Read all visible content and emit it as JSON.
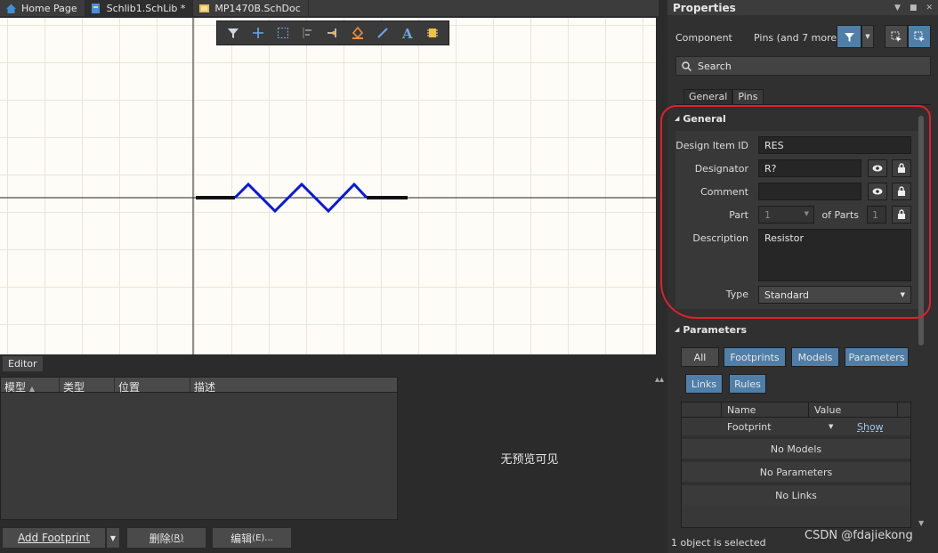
{
  "tabs": [
    {
      "label": "Home Page",
      "icon": "home-icon"
    },
    {
      "label": "Schlib1.SchLib *",
      "icon": "schlib-file-icon"
    },
    {
      "label": "MP1470B.SchDoc",
      "icon": "schdoc-file-icon"
    }
  ],
  "canvas_toolbar": {
    "tools": [
      "filter-icon",
      "add-crosshair-icon",
      "select-rect-icon",
      "align-icon",
      "pin-icon",
      "fill-icon",
      "line-icon",
      "text-icon",
      "component-icon"
    ]
  },
  "editor": {
    "tab_label": "Editor",
    "columns": [
      "模型",
      "类型",
      "位置",
      "描述"
    ],
    "preview_empty": "无预览可见",
    "buttons": {
      "add_footprint": "Add Footprint",
      "delete": "删除 ",
      "delete_key": "(R)",
      "edit": "编辑 ",
      "edit_key": "(E)..."
    }
  },
  "properties": {
    "title": "Properties",
    "component_label": "Component",
    "selection_filter": "Pins (and 7 more)",
    "search_placeholder": "Search",
    "subtabs": [
      "General",
      "Pins"
    ],
    "general": {
      "header": "General",
      "design_item_id_label": "Design Item ID",
      "design_item_id": "RES",
      "designator_label": "Designator",
      "designator": "R?",
      "comment_label": "Comment",
      "comment": "",
      "part_label": "Part",
      "part": "1",
      "of_parts_label": "of Parts",
      "of_parts": "1",
      "description_label": "Description",
      "description": "Resistor",
      "type_label": "Type",
      "type": "Standard"
    },
    "parameters": {
      "header": "Parameters",
      "filters": [
        "All",
        "Footprints",
        "Models",
        "Parameters",
        "Links",
        "Rules"
      ],
      "columns": [
        "Name",
        "Value"
      ],
      "rows": [
        {
          "name": "Footprint",
          "action": "Show"
        }
      ],
      "empty_models": "No Models",
      "empty_parameters": "No Parameters",
      "empty_links": "No Links"
    },
    "status": "1 object is selected"
  },
  "watermark": "CSDN @fdajiekong",
  "colors": {
    "accent_blue": "#4f7fa8",
    "highlight_red": "#e2202a",
    "resistor_blue": "#0a18d8",
    "canvas_bg": "#fdfcf6"
  }
}
